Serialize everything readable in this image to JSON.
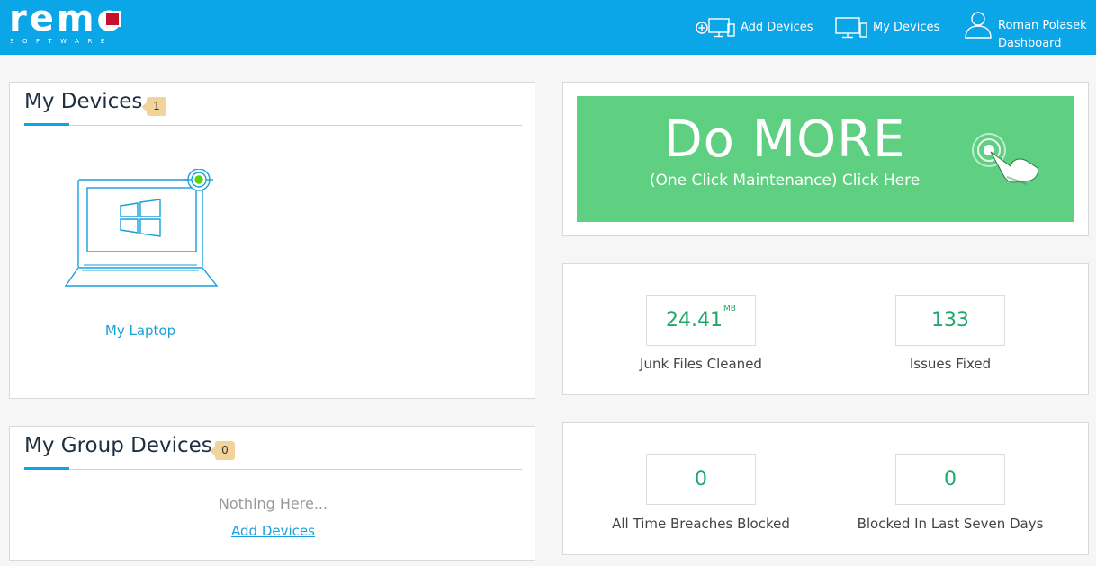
{
  "header": {
    "logo_text": "remo",
    "logo_sub": "SOFTWARE",
    "nav": {
      "add_devices": "Add Devices",
      "my_devices": "My Devices"
    },
    "user": {
      "name": "Roman Polasek",
      "subtitle": "Dashboard"
    }
  },
  "my_devices": {
    "title": "My Devices",
    "count": "1",
    "devices": [
      {
        "label": "My Laptop",
        "icon": "windows-laptop-icon",
        "status": "online"
      }
    ]
  },
  "group_devices": {
    "title": "My Group Devices",
    "count": "0",
    "empty_text": "Nothing Here...",
    "add_link": "Add Devices"
  },
  "do_more": {
    "title": "Do MORE",
    "subtitle": "(One Click Maintenance) Click Here",
    "icon": "tap-hand-icon"
  },
  "stats": {
    "junk": {
      "value": "24.41",
      "unit": "MB",
      "label": "Junk Files Cleaned"
    },
    "issues": {
      "value": "133",
      "label": "Issues Fixed"
    },
    "breaches_all": {
      "value": "0",
      "label": "All Time Breaches Blocked"
    },
    "breaches_week": {
      "value": "0",
      "label": "Blocked In Last Seven Days"
    }
  },
  "colors": {
    "header": "#0aa6e8",
    "accent": "#0aa6e8",
    "do_more": "#5fd081",
    "stat_value": "#20a86a",
    "badge": "#f2d49b",
    "logo_red": "#c8102e"
  }
}
